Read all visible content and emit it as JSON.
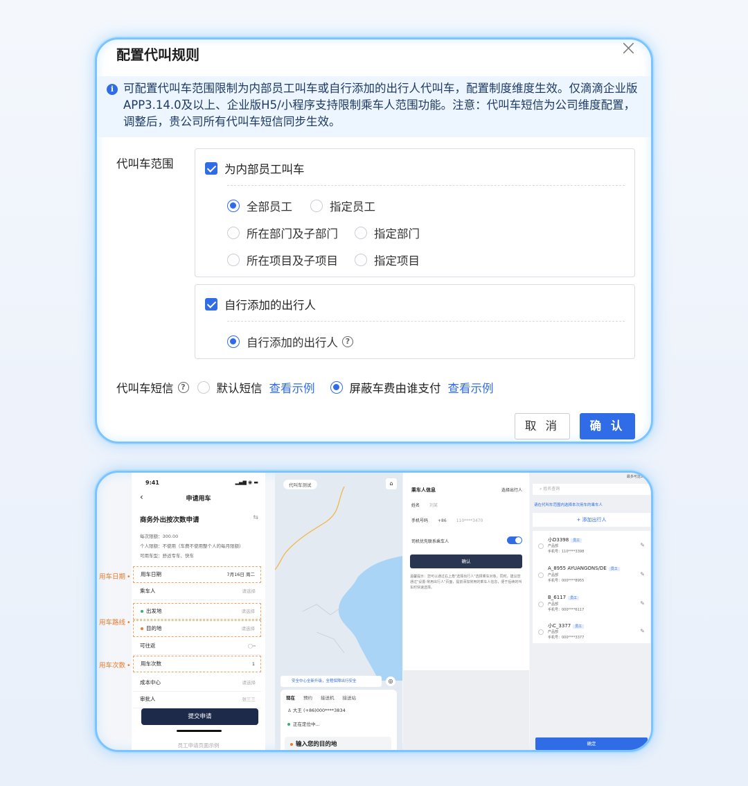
{
  "dialog": {
    "title": "配置代叫规则",
    "close_label": "×",
    "notice": "可配置代叫车范围限制为内部员工叫车或自行添加的出行人代叫车，配置制度维度生效。仅滴滴企业版APP3.14.0及以上、企业版H5/小程序支持限制乘车人范围功能。注意：代叫车短信为公司维度配置，调整后，贵公司所有代叫车短信同步生效。",
    "scope_label": "代叫车范围",
    "internal": {
      "label": "为内部员工叫车",
      "options": [
        "全部员工",
        "指定员工",
        "所在部门及子部门",
        "指定部门",
        "所在项目及子项目",
        "指定项目"
      ],
      "selected": "全部员工"
    },
    "self_added": {
      "label": "自行添加的出行人",
      "option": "自行添加的出行人"
    },
    "sms": {
      "label": "代叫车短信",
      "option1": "默认短信",
      "option2": "屏蔽车费由谁支付",
      "link": "查看示例",
      "selected": "屏蔽车费由谁支付"
    },
    "cancel": "取 消",
    "confirm": "确 认"
  },
  "phone": {
    "time": "9:41",
    "nav_title": "申请用车",
    "card_title": "商务外出按次数申请",
    "lines": [
      "每次限额：300.00",
      "个人限额：不使用（车费不使用整个人的每月限额）",
      "可用车型：舒适专车、快车"
    ],
    "side_labels": [
      "用车日期",
      "用车路线",
      "用车次数"
    ],
    "rows": {
      "date": "用车日期",
      "date_value": "7月16日 周二",
      "passenger": "乘车人",
      "placeholder": "请选择",
      "origin": "出发地",
      "destination": "目的地",
      "round_trip": "可往返",
      "times": "用车次数",
      "times_value": "1",
      "cost_center": "成本中心",
      "approver": "审批人",
      "approver_value": "张三三"
    },
    "submit": "提交申请",
    "caption": "员工申请页面示例"
  },
  "map": {
    "chip": "代叫车测试",
    "banner": "安全中心全新升级，全程保障出行安全",
    "tabs": [
      "现在",
      "预约",
      "接送机",
      "接送站"
    ],
    "passenger_line": "大王 (+86)000****3834",
    "locating": "正在定位中...",
    "destination": "输入您的目的地"
  },
  "form": {
    "title": "乘车人信息",
    "select_link": "选择出行人",
    "name_label": "姓名",
    "name_placeholder": "刘某",
    "phone_label": "手机号码",
    "phone_prefix": "+86",
    "phone_placeholder": "110****3470",
    "toggle_label": "司机优先联系乘车人",
    "confirm": "确认",
    "note": "温馨提示：您可以通过右上角\"选择出行人\"选择乘车对象。同时，建议您通过\"设置-常用出行人\"页面，提前添加常用的乘车人信息，便于后续的叫车时快速选择。"
  },
  "list": {
    "top_hint": "最多可选1人",
    "search_placeholder": "姓名查询",
    "hint": "请在代叫车范围内选择本次用车的乘车人",
    "add": "+ 添加出行人",
    "items": [
      {
        "name": "小D3398",
        "tag": "员工",
        "dept": "产品部",
        "phone": "手机号：110****3398"
      },
      {
        "name": "A_8955 AYUANGONS/DE",
        "tag": "员工",
        "dept": "产品部",
        "phone": "手机号：000****8955"
      },
      {
        "name": "B_6117",
        "tag": "员工",
        "dept": "产品部",
        "phone": "手机号：000****6117"
      },
      {
        "name": "小C_3377",
        "tag": "员工",
        "dept": "产品部",
        "phone": "手机号：000****3377"
      }
    ],
    "confirm": "确定"
  },
  "colors": {
    "accent": "#2f6ce5",
    "glow": "#7cc4ff",
    "highlight": "#f07a2a"
  }
}
